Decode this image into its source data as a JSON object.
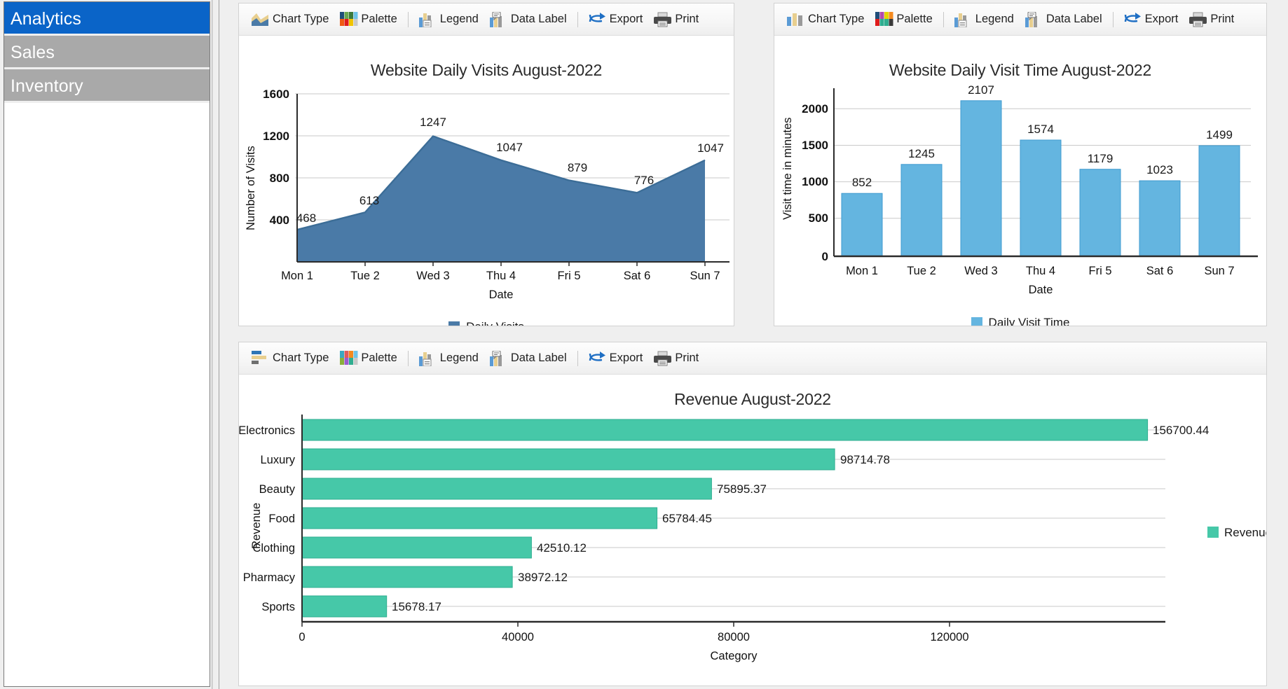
{
  "sidebar": {
    "items": [
      {
        "label": "Analytics",
        "selected": true
      },
      {
        "label": "Sales",
        "selected": false
      },
      {
        "label": "Inventory",
        "selected": false
      }
    ]
  },
  "toolbar": {
    "chart_type": "Chart Type",
    "palette": "Palette",
    "legend": "Legend",
    "data_label": "Data Label",
    "export": "Export",
    "print": "Print"
  },
  "colors": {
    "area_fill": "#4a7aa7",
    "area_line": "#3c6d97",
    "bar_blue": "#64b5e0",
    "bar_blue_border": "#3f9bd0",
    "bar_teal": "#46c8a8",
    "bar_teal_border": "#2fae90",
    "selected_nav": "#0a64c8",
    "nav_item": "#a9a9a9"
  },
  "chart_data": [
    {
      "id": "visits",
      "type": "area",
      "title": "Website Daily Visits August-2022",
      "xlabel": "Date",
      "ylabel": "Number of Visits",
      "categories": [
        "Mon 1",
        "Tue 2",
        "Wed 3",
        "Thu 4",
        "Fri 5",
        "Sat 6",
        "Sun 7"
      ],
      "values": [
        468,
        613,
        1247,
        1047,
        879,
        776,
        1047
      ],
      "yticks": [
        400,
        800,
        1200,
        1600
      ],
      "ylim": [
        200,
        1600
      ],
      "grid": true,
      "legend_position": "bottom",
      "series": [
        {
          "name": "Daily Visits",
          "values": [
            468,
            613,
            1247,
            1047,
            879,
            776,
            1047
          ]
        }
      ],
      "legend": [
        "Daily Visits"
      ]
    },
    {
      "id": "visittime",
      "type": "bar",
      "title": "Website Daily Visit Time August-2022",
      "xlabel": "Date",
      "ylabel": "Visit time in minutes",
      "categories": [
        "Mon 1",
        "Tue 2",
        "Wed 3",
        "Thu 4",
        "Fri 5",
        "Sat 6",
        "Sun 7"
      ],
      "values": [
        852,
        1245,
        2107,
        1574,
        1179,
        1023,
        1499
      ],
      "yticks": [
        0,
        500,
        1000,
        1500,
        2000
      ],
      "ylim": [
        0,
        2200
      ],
      "grid": true,
      "legend_position": "bottom",
      "series": [
        {
          "name": "Daily Visit Time",
          "values": [
            852,
            1245,
            2107,
            1574,
            1179,
            1023,
            1499
          ]
        }
      ],
      "legend": [
        "Daily Visit Time"
      ]
    },
    {
      "id": "revenue",
      "type": "bar-horizontal",
      "title": "Revenue August-2022",
      "xlabel": "Category",
      "ylabel": "Revenue",
      "categories": [
        "Electronics",
        "Luxury",
        "Beauty",
        "Food",
        "Clothing",
        "Pharmacy",
        "Sports"
      ],
      "values": [
        156700.44,
        98714.78,
        75895.37,
        65784.45,
        42510.12,
        38972.12,
        15678.17
      ],
      "value_labels": [
        "156700.44",
        "98714.78",
        "75895.37",
        "65784.45",
        "42510.12",
        "38972.12",
        "15678.17"
      ],
      "xticks": [
        0,
        40000,
        80000,
        120000
      ],
      "xtick_labels": [
        "0",
        "40000",
        "80000",
        "120000"
      ],
      "xlim": [
        0,
        160000
      ],
      "grid": true,
      "legend_position": "right",
      "series": [
        {
          "name": "Revenue",
          "values": [
            156700.44,
            98714.78,
            75895.37,
            65784.45,
            42510.12,
            38972.12,
            15678.17
          ]
        }
      ],
      "legend": [
        "Revenue"
      ]
    }
  ]
}
